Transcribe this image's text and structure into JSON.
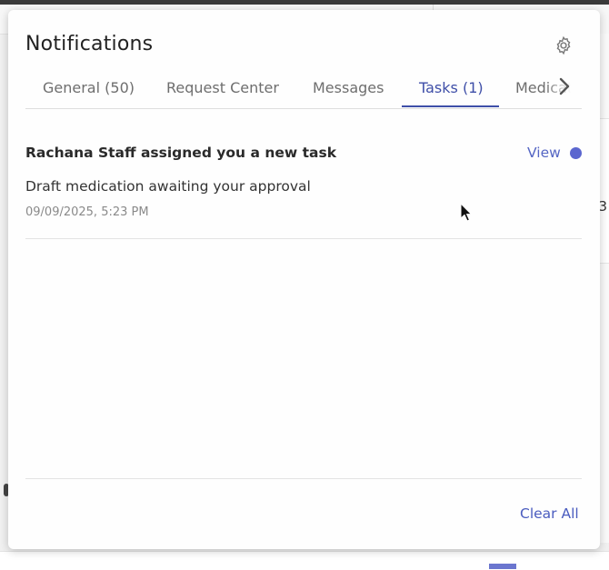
{
  "panel": {
    "title": "Notifications",
    "settings_icon": "gear-icon",
    "tabs": [
      {
        "label": "General (50)",
        "active": false
      },
      {
        "label": "Request Center",
        "active": false
      },
      {
        "label": "Messages",
        "active": false
      },
      {
        "label": "Tasks (1)",
        "active": true
      },
      {
        "label": "Medicatio",
        "active": false
      }
    ],
    "scroll_icon": "chevron-right-icon"
  },
  "notifications": [
    {
      "title": "Rachana Staff assigned you a new task",
      "action_label": "View",
      "body": "Draft medication awaiting your approval",
      "timestamp": "09/09/2025, 5:23 PM",
      "unread": true
    }
  ],
  "footer": {
    "clear_all_label": "Clear All"
  },
  "background": {
    "edge_text": "3"
  },
  "colors": {
    "accent": "#3f4fa8",
    "unread_dot": "#5b66cf"
  }
}
